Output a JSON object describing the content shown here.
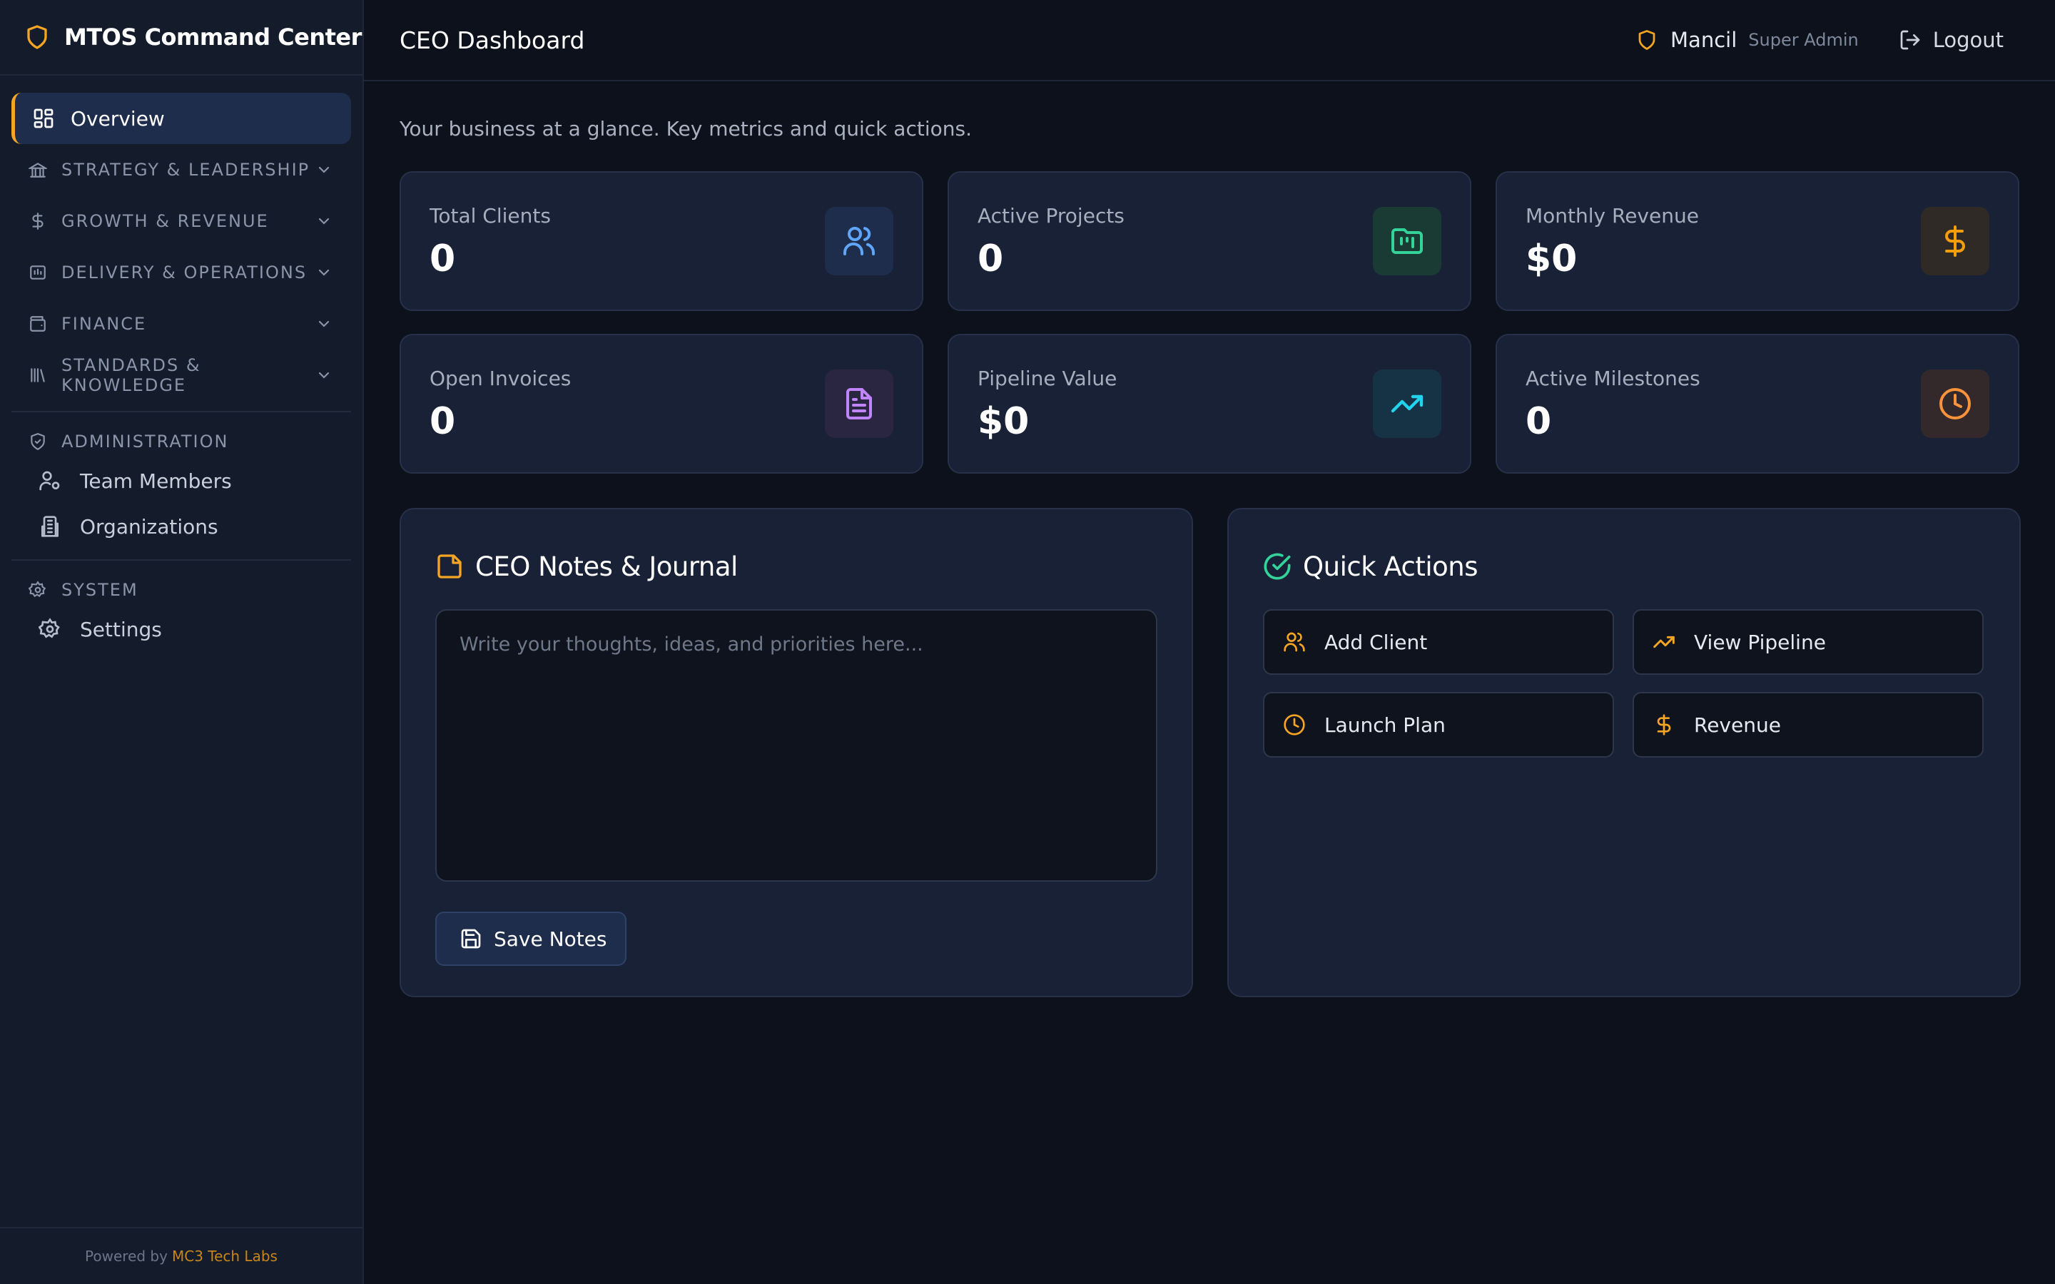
{
  "app": {
    "title": "MTOS Command Center"
  },
  "sidebar": {
    "overview_label": "Overview",
    "groups": [
      {
        "label": "STRATEGY & LEADERSHIP",
        "icon": "landmark-icon"
      },
      {
        "label": "GROWTH & REVENUE",
        "icon": "dollar-icon"
      },
      {
        "label": "DELIVERY & OPERATIONS",
        "icon": "building-icon"
      },
      {
        "label": "FINANCE",
        "icon": "wallet-icon"
      },
      {
        "label": "STANDARDS & KNOWLEDGE",
        "icon": "library-icon"
      }
    ],
    "admin": {
      "heading": "ADMINISTRATION",
      "items": [
        {
          "label": "Team Members",
          "icon": "user-cog-icon"
        },
        {
          "label": "Organizations",
          "icon": "building2-icon"
        }
      ]
    },
    "system": {
      "heading": "SYSTEM",
      "items": [
        {
          "label": "Settings",
          "icon": "gear-icon"
        }
      ]
    },
    "footer": {
      "prefix": "Powered by",
      "brand": "MC3 Tech Labs"
    }
  },
  "header": {
    "page_title": "CEO Dashboard",
    "user_name": "Mancil",
    "user_role": "Super Admin",
    "logout_label": "Logout"
  },
  "main": {
    "subtitle": "Your business at a glance. Key metrics and quick actions.",
    "stats": [
      {
        "label": "Total Clients",
        "value": "0",
        "icon": "users-icon",
        "color": "#60a5fa"
      },
      {
        "label": "Active Projects",
        "value": "0",
        "icon": "folder-kanban-icon",
        "color": "#34d399"
      },
      {
        "label": "Monthly Revenue",
        "value": "$0",
        "icon": "dollar-icon",
        "color": "#f59e0b"
      },
      {
        "label": "Open Invoices",
        "value": "0",
        "icon": "file-text-icon",
        "color": "#c084fc"
      },
      {
        "label": "Pipeline Value",
        "value": "$0",
        "icon": "trending-up-icon",
        "color": "#22d3ee"
      },
      {
        "label": "Active Milestones",
        "value": "0",
        "icon": "clock-icon",
        "color": "#fb923c"
      }
    ],
    "notes": {
      "title": "CEO Notes & Journal",
      "placeholder": "Write your thoughts, ideas, and priorities here...",
      "value": "",
      "save_label": "Save Notes"
    },
    "quick_actions": {
      "title": "Quick Actions",
      "items": [
        {
          "label": "Add Client",
          "icon": "users-icon"
        },
        {
          "label": "View Pipeline",
          "icon": "trending-up-icon"
        },
        {
          "label": "Launch Plan",
          "icon": "clock-icon"
        },
        {
          "label": "Revenue",
          "icon": "dollar-icon"
        }
      ]
    }
  },
  "colors": {
    "accent": "#f5a524",
    "background": "#0d111b",
    "sidebar": "#141b2b",
    "card": "#182135",
    "success": "#34d399"
  }
}
